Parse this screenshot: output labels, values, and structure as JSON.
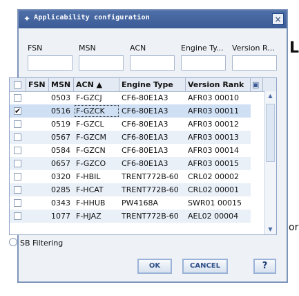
{
  "dialog": {
    "title": "Applicability configuration",
    "close_glyph": "×",
    "title_icon": "app-icon"
  },
  "filters": {
    "labels": [
      "FSN",
      "MSN",
      "ACN",
      "Engine Ty...",
      "Version R..."
    ]
  },
  "grid": {
    "columns": [
      "",
      "FSN",
      "MSN",
      "ACN ▲",
      "Engine Type",
      "Version Rank"
    ],
    "rows": [
      {
        "checked": false,
        "fsn": "",
        "msn": "0503",
        "acn": "F-GZCJ",
        "engine": "CF6-80E1A3",
        "version": "AFR03 00010"
      },
      {
        "checked": true,
        "fsn": "",
        "msn": "0516",
        "acn": "F-GZCK",
        "engine": "CF6-80E1A3",
        "version": "AFR03 00011"
      },
      {
        "checked": false,
        "fsn": "",
        "msn": "0519",
        "acn": "F-GZCL",
        "engine": "CF6-80E1A3",
        "version": "AFR03 00012"
      },
      {
        "checked": false,
        "fsn": "",
        "msn": "0567",
        "acn": "F-GZCM",
        "engine": "CF6-80E1A3",
        "version": "AFR03 00013"
      },
      {
        "checked": false,
        "fsn": "",
        "msn": "0584",
        "acn": "F-GZCN",
        "engine": "CF6-80E1A3",
        "version": "AFR03 00014"
      },
      {
        "checked": false,
        "fsn": "",
        "msn": "0657",
        "acn": "F-GZCO",
        "engine": "CF6-80E1A3",
        "version": "AFR03 00015"
      },
      {
        "checked": false,
        "fsn": "",
        "msn": "0320",
        "acn": "F-HBIL",
        "engine": "TRENT772B-60",
        "version": "CRL02 00002"
      },
      {
        "checked": false,
        "fsn": "",
        "msn": "0285",
        "acn": "F-HCAT",
        "engine": "TRENT772B-60",
        "version": "CRL02 00001"
      },
      {
        "checked": false,
        "fsn": "",
        "msn": "0343",
        "acn": "F-HHUB",
        "engine": "PW4168A",
        "version": "SWR01 00015"
      },
      {
        "checked": false,
        "fsn": "",
        "msn": "1077",
        "acn": "F-HJAZ",
        "engine": "TRENT772B-60",
        "version": "AEL02 00004"
      }
    ],
    "checkmark": "✔",
    "column_chooser_icon": "column-chooser-icon"
  },
  "sb_filtering": "SB Filtering",
  "buttons": {
    "ok": "OK",
    "cancel": "CANCEL",
    "help": "?"
  },
  "background_fragments": {
    "right_L": "L",
    "right_or": "or"
  }
}
